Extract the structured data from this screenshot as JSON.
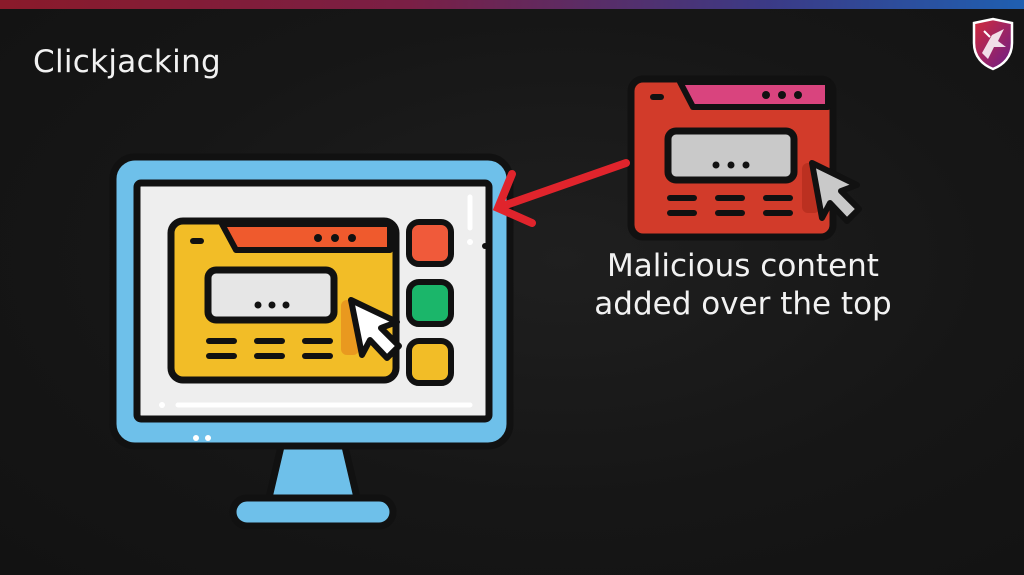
{
  "slide": {
    "title": "Clickjacking",
    "caption_line1": "Malicious content",
    "caption_line2": "added over the top"
  },
  "icons": {
    "logo": "shield-logo-icon",
    "monitor": "monitor-icon",
    "legit_window": "browser-window-icon",
    "overlay_window": "malicious-overlay-window-icon",
    "cursor": "cursor-pointer-icon",
    "arrow": "red-arrow-icon"
  },
  "colors": {
    "background": "#161616",
    "monitor_frame": "#6ec0ea",
    "legit_window": "#f2bd27",
    "overlay_window": "#d23b2a",
    "overlay_tab": "#d9447e",
    "legit_tab": "#ef5a2d",
    "arrow": "#e0242c",
    "square_orange": "#f05a3a",
    "square_green": "#1bb66a",
    "square_yellow": "#f2bd27"
  }
}
